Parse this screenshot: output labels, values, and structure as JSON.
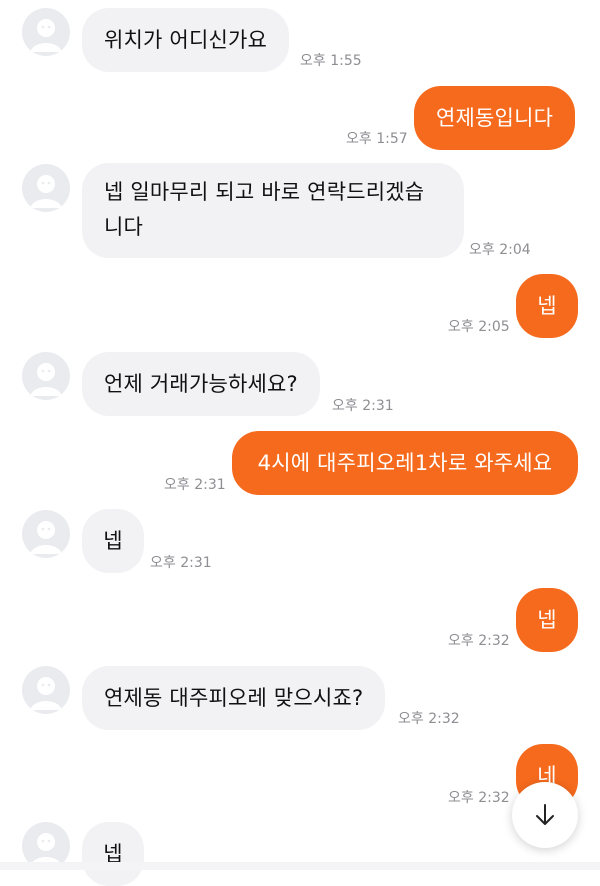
{
  "messages": [
    {
      "text": "위치가 어디신가요",
      "time": "오후 1:55"
    },
    {
      "text": "연제동입니다",
      "time": "오후 1:57"
    },
    {
      "text": "넵 일마무리 되고 바로 연락드리겠습니다",
      "time": "오후 2:04"
    },
    {
      "text": "넵",
      "time": "오후 2:05"
    },
    {
      "text": "언제 거래가능하세요?",
      "time": "오후 2:31"
    },
    {
      "text": "4시에 대주피오레1차로 와주세요",
      "time": "오후 2:31"
    },
    {
      "text": "넵",
      "time": "오후 2:31"
    },
    {
      "text": "넵",
      "time": "오후 2:32"
    },
    {
      "text": "연제동 대주피오레 맞으시죠?",
      "time": "오후 2:32"
    },
    {
      "text": "네",
      "time": "오후 2:32"
    },
    {
      "text": "넵",
      "time": ""
    }
  ],
  "colors": {
    "incoming_bubble": "#f2f2f5",
    "outgoing_bubble": "#f56a1d"
  },
  "icons": {
    "avatar": "default-profile-icon",
    "scroll": "arrow-down-icon"
  }
}
